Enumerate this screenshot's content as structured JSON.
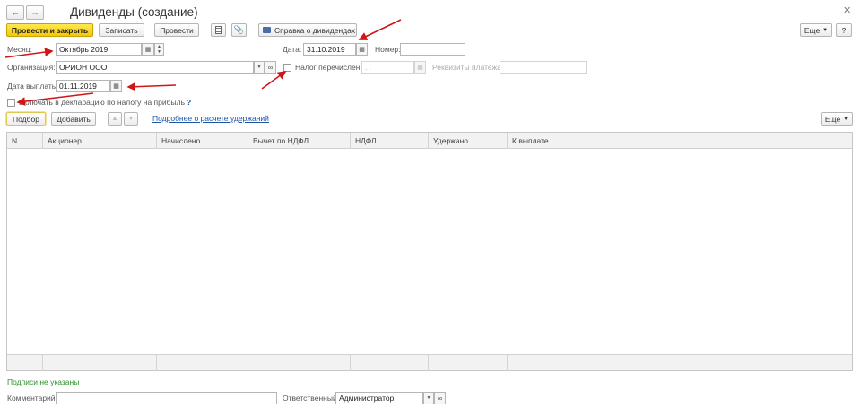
{
  "window": {
    "title": "Дивиденды (создание)",
    "nav_back_icon": "arrow-left-icon",
    "nav_forward_icon": "arrow-right-icon",
    "close_icon": "close-icon"
  },
  "toolbar": {
    "post_and_close": "Провести и закрыть",
    "save": "Записать",
    "post": "Провести",
    "report_icon": "document-icon",
    "attach_icon": "paperclip-icon",
    "print_label": "Справка о дивидендах",
    "more": "Еще"
  },
  "form": {
    "month_label": "Месяц:",
    "month_value": "Октябрь 2019",
    "date_label": "Дата:",
    "date_value": "31.10.2019",
    "number_label": "Номер:",
    "number_value": "",
    "org_label": "Организация:",
    "org_value": "ОРИОН ООО",
    "tax_paid_label": "Налог перечислен:",
    "tax_paid_date_placeholder": " .  .",
    "payment_details_label": "Реквизиты платежа:",
    "payment_date_label": "Дата выплаты:",
    "payment_date_value": "01.11.2019",
    "include_decl_label": "Включать в декларацию по налогу на прибыль",
    "help_mark": "?"
  },
  "table_toolbar": {
    "select": "Подбор",
    "add": "Добавить",
    "details_link": "Подробнее о расчете удержаний",
    "more": "Еще"
  },
  "table": {
    "columns": [
      "N",
      "Акционер",
      "Начислено",
      "Вычет по НДФЛ",
      "НДФЛ",
      "Удержано",
      "К выплате"
    ],
    "rows": []
  },
  "footer": {
    "signatures_link": "Подписи не указаны",
    "comment_label": "Комментарий:",
    "comment_value": "",
    "responsible_label": "Ответственный:",
    "responsible_value": "Администратор"
  },
  "colors": {
    "primary_button": "#f4c80a",
    "link": "#1a55a8",
    "annotation_arrow": "#d01515"
  }
}
